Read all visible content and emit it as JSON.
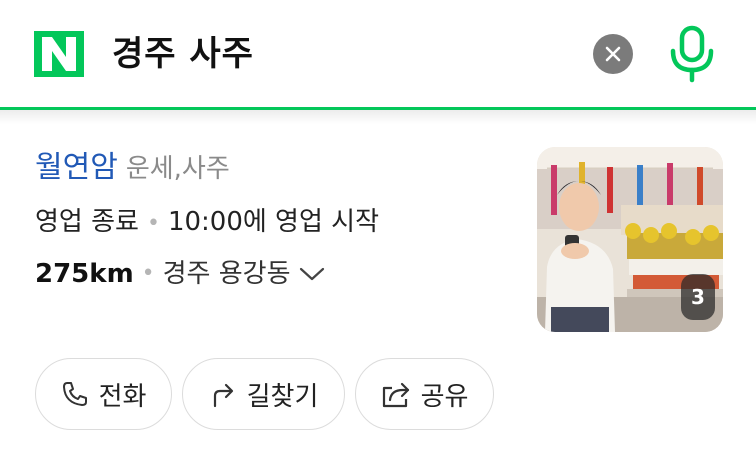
{
  "search": {
    "logo_letter": "N",
    "query": "경주 사주",
    "clear_icon": "close-icon",
    "mic_icon": "microphone-icon",
    "accent_color": "#03c75a"
  },
  "place": {
    "name": "월연암",
    "category": "운세,사주",
    "status": "영업 종료",
    "hours_note": "10:00에 영업 시작",
    "distance": "275km",
    "address": "경주 용강동",
    "photo_count": "3",
    "name_color": "#2159b6"
  },
  "actions": [
    {
      "label": "전화",
      "icon": "phone-icon"
    },
    {
      "label": "길찾기",
      "icon": "directions-arrow-icon"
    },
    {
      "label": "공유",
      "icon": "share-icon"
    }
  ]
}
